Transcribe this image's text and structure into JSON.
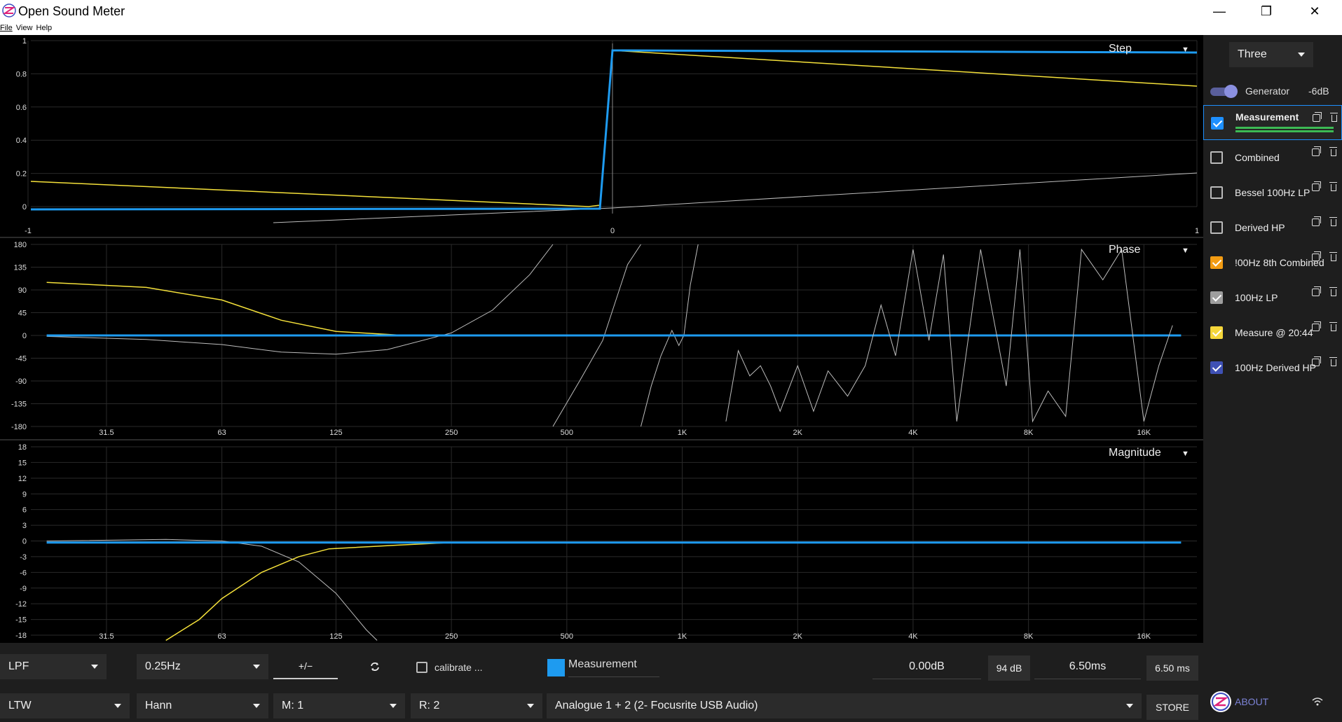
{
  "window": {
    "title": "Open Sound Meter",
    "minimize": "—",
    "maximize": "❐",
    "close": "✕"
  },
  "menu": {
    "file": "File",
    "view": "View",
    "help": "Help"
  },
  "plots": {
    "step": {
      "label": "Step",
      "y_ticks": [
        "1",
        "0.8",
        "0.6",
        "0.4",
        "0.2",
        "0"
      ],
      "x_ticks": [
        "-1",
        "0",
        "1"
      ]
    },
    "phase": {
      "label": "Phase",
      "y_ticks": [
        "180",
        "135",
        "90",
        "45",
        "0",
        "-45",
        "-90",
        "-135",
        "-180"
      ],
      "x_ticks": [
        "31.5",
        "63",
        "125",
        "250",
        "500",
        "1K",
        "2K",
        "4K",
        "8K",
        "16K"
      ]
    },
    "magnitude": {
      "label": "Magnitude",
      "y_ticks": [
        "18",
        "15",
        "12",
        "9",
        "6",
        "3",
        "0",
        "-3",
        "-6",
        "-9",
        "-12",
        "-15",
        "-18"
      ],
      "x_ticks": [
        "31.5",
        "63",
        "125",
        "250",
        "500",
        "1K",
        "2K",
        "4K",
        "8K",
        "16K"
      ]
    }
  },
  "sidebar": {
    "layout": "Three",
    "generator_label": "Generator",
    "generator_level": "-6dB",
    "measurements": [
      {
        "name": "Measurement",
        "checked": true,
        "color": "#1e90ff"
      },
      {
        "name": "Combined",
        "checked": false,
        "color": ""
      },
      {
        "name": "Bessel 100Hz LP",
        "checked": false,
        "color": ""
      },
      {
        "name": "Derived HP",
        "checked": false,
        "color": ""
      },
      {
        "name": "!00Hz 8th Combined",
        "checked": true,
        "color": "#f39c12"
      },
      {
        "name": "100Hz LP",
        "checked": true,
        "color": "#9e9e9e"
      },
      {
        "name": "Measure @ 20:44",
        "checked": true,
        "color": "#f5d63a"
      },
      {
        "name": "100Hz Derived HP",
        "checked": true,
        "color": "#3f51b5"
      }
    ],
    "about": "ABOUT"
  },
  "controls": {
    "filter": "LPF",
    "filter_freq": "0.25Hz",
    "polarity": "+/−",
    "calibrate": "calibrate ...",
    "active_name": "Measurement",
    "active_color": "#1e9bf0",
    "gain": "0.00dB",
    "spl": "94 dB",
    "delay": "6.50ms",
    "delay_btn": "6.50 ms",
    "average": "LTW",
    "window": "Hann",
    "m_channel": "M: 1",
    "r_channel": "R: 2",
    "device": "Analogue 1 + 2 (2- Focusrite USB Audio)",
    "store": "STORE"
  },
  "colors": {
    "blue": "#1e9bf0",
    "yellow": "#f5e13a",
    "grey": "#bdbdbd",
    "accent": "#7c83d6"
  }
}
